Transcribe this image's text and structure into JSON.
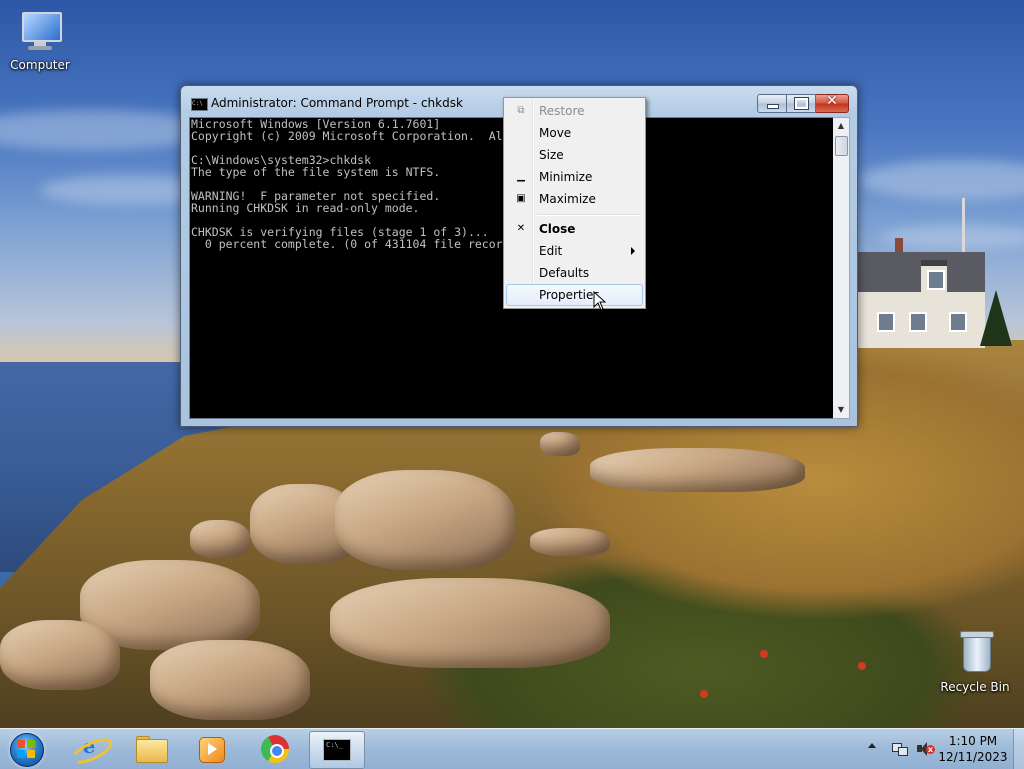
{
  "desktop": {
    "icons": [
      {
        "label": "Computer",
        "icon": "computer-icon"
      },
      {
        "label": "Recycle Bin",
        "icon": "recycle-bin-icon"
      }
    ]
  },
  "window": {
    "title": "Administrator:  Command Prompt - chkdsk",
    "icon": "cmd-icon",
    "console_lines": [
      "Microsoft Windows [Version 6.1.7601]",
      "Copyright (c) 2009 Microsoft Corporation.  All rights reserved.",
      "",
      "C:\\Windows\\system32>chkdsk",
      "The type of the file system is NTFS.",
      "",
      "WARNING!  F parameter not specified.",
      "Running CHKDSK in read-only mode.",
      "",
      "CHKDSK is verifying files (stage 1 of 3)...",
      "  0 percent complete. (0 of 431104 file records processed)"
    ]
  },
  "context_menu": {
    "items": [
      {
        "label": "Restore",
        "state": "disabled",
        "icon": "restore-icon"
      },
      {
        "label": "Move",
        "state": "normal",
        "icon": ""
      },
      {
        "label": "Size",
        "state": "normal",
        "icon": ""
      },
      {
        "label": "Minimize",
        "state": "normal",
        "icon": "minimize-icon"
      },
      {
        "label": "Maximize",
        "state": "normal",
        "icon": "maximize-icon"
      },
      {
        "label": "Close",
        "state": "bold",
        "icon": "close-icon"
      },
      {
        "label": "Edit",
        "state": "submenu",
        "icon": ""
      },
      {
        "label": "Defaults",
        "state": "normal",
        "icon": ""
      },
      {
        "label": "Properties",
        "state": "hover",
        "icon": ""
      }
    ]
  },
  "taskbar": {
    "pinned": [
      "start-orb",
      "internet-explorer",
      "windows-explorer",
      "windows-media-player",
      "google-chrome",
      "command-prompt"
    ],
    "active": "command-prompt",
    "clock": {
      "time": "1:10 PM",
      "date": "12/11/2023"
    }
  }
}
